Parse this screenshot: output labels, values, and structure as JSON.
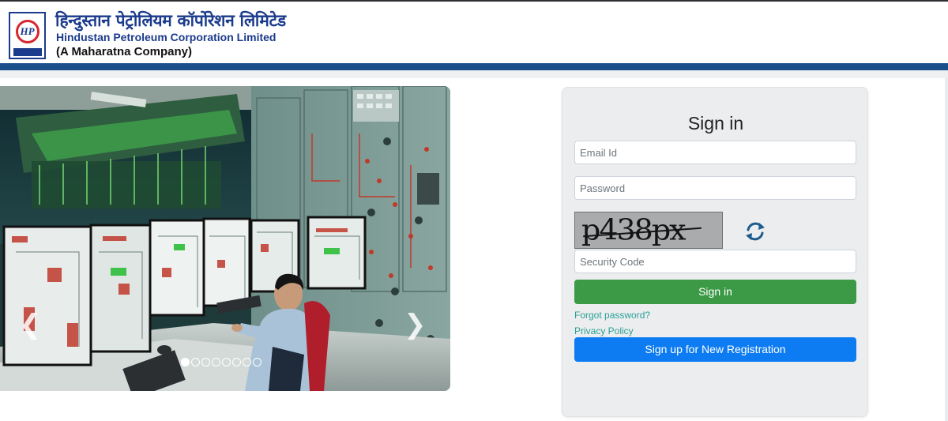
{
  "header": {
    "title_hindi": "हिन्दुस्तान पेट्रोलियम कॉर्पोरेशन लिमिटेड",
    "title_english": "Hindustan Petroleum Corporation Limited",
    "tagline": "(A Maharatna Company)",
    "logo_text": "HP",
    "brand_color": "#1b3b8c"
  },
  "carousel": {
    "prev_icon": "chevron-left-icon",
    "next_icon": "chevron-right-icon",
    "slide_count": 8,
    "active_slide": 1
  },
  "login": {
    "title": "Sign in",
    "email_placeholder": "Email Id",
    "password_placeholder": "Password",
    "captcha_text": "p438px",
    "refresh_icon": "refresh-icon",
    "security_placeholder": "Security Code",
    "signin_label": "Sign in",
    "forgot_label": "Forgot password?",
    "privacy_label": "Privacy Policy",
    "signup_label": "Sign up for New Registration",
    "colors": {
      "signin_button": "#3c9a47",
      "signup_button": "#0d7cf2",
      "link": "#2aa198"
    }
  }
}
